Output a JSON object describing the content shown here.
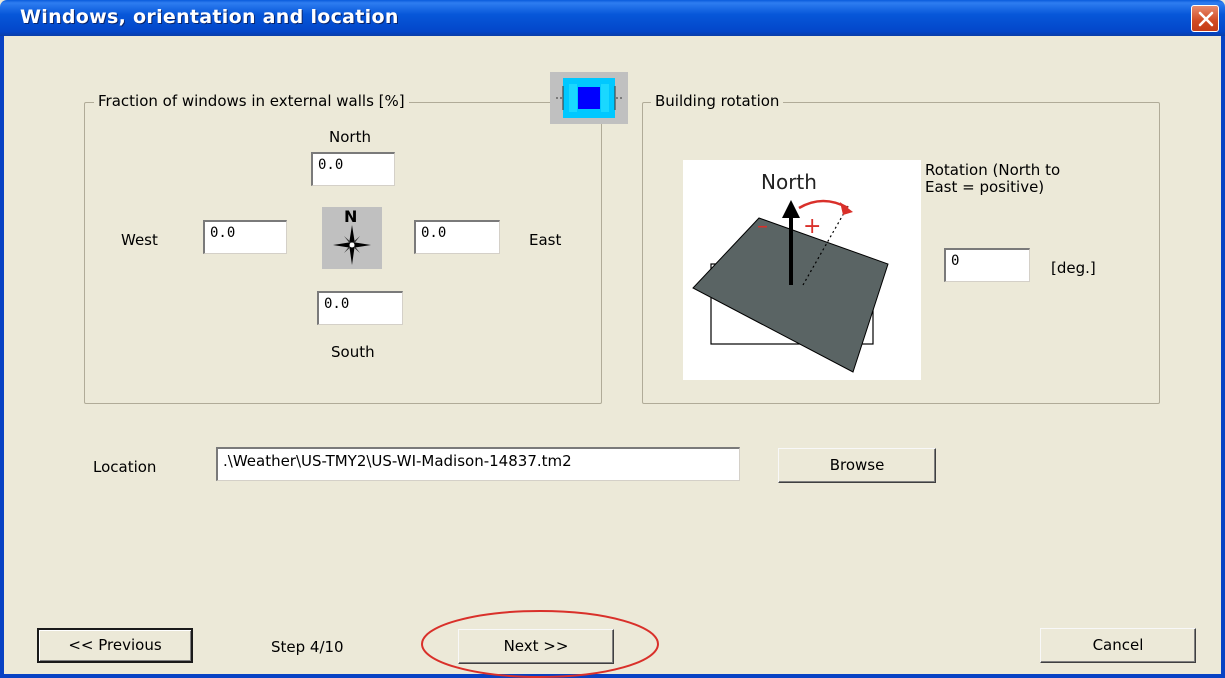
{
  "window": {
    "title": "Windows, orientation and location"
  },
  "windows_group": {
    "legend": "Fraction of windows in external walls [%]",
    "north_label": "North",
    "south_label": "South",
    "west_label": "West",
    "east_label": "East",
    "north_value": "0.0",
    "south_value": "0.0",
    "west_value": "0.0",
    "east_value": "0.0",
    "compass_letter": "N"
  },
  "rotation_group": {
    "legend": "Building rotation",
    "diagram_north": "North",
    "minus_sign": "–",
    "plus_sign": "+",
    "rotation_label_line1": "Rotation (North to",
    "rotation_label_line2": "East = positive)",
    "rotation_value": "0",
    "unit": "[deg.]"
  },
  "location": {
    "label": "Location",
    "value": ".\\Weather\\US-TMY2\\US-WI-Madison-14837.tm2",
    "browse_label": "Browse"
  },
  "footer": {
    "previous_label": "<< Previous",
    "step_text": "Step 4/10",
    "next_label": "Next >>",
    "cancel_label": "Cancel"
  },
  "colors": {
    "titlebar": "#0757d9",
    "dialog_bg": "#ece9d8",
    "highlight_ellipse": "#d9302a",
    "building_fill": "#5a6464",
    "arrow_red": "#d9302a"
  }
}
